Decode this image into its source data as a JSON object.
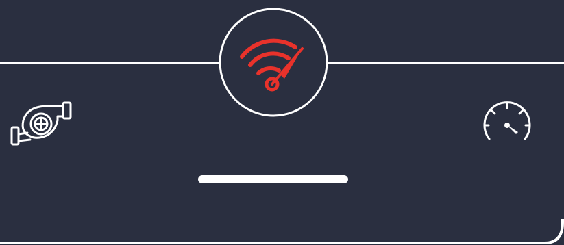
{
  "colors": {
    "background": "#2a2f40",
    "line": "#ffffff",
    "accent": "#e8322b",
    "icon": "#ffffff"
  },
  "center_badge": {
    "icon": "wifi-speed-gauge-icon"
  },
  "left_button": {
    "icon": "turbocharger-icon"
  },
  "right_button": {
    "icon": "speedometer-icon"
  },
  "home_indicator": {
    "present": true
  }
}
